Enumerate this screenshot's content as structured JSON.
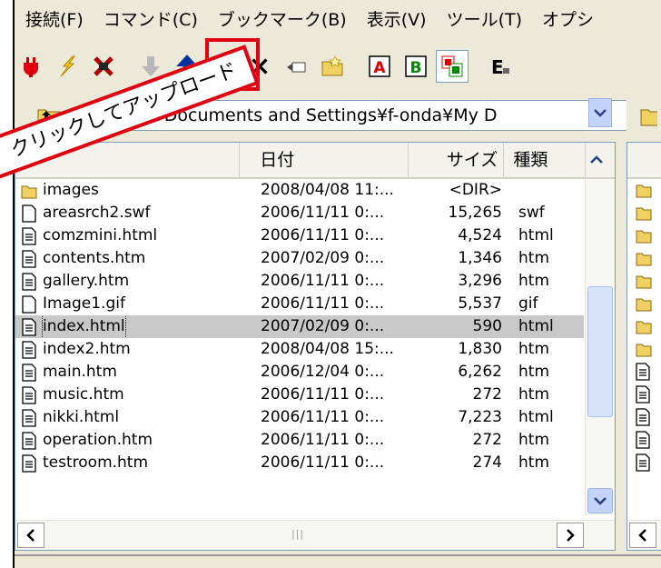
{
  "menu": [
    "接続(F)",
    "コマンド(C)",
    "ブックマーク(B)",
    "表示(V)",
    "ツール(T)",
    "オプシ"
  ],
  "toolbar": {
    "buttons": [
      {
        "name": "connect-plug-icon"
      },
      {
        "name": "quick-connect-bolt-icon"
      },
      {
        "name": "disconnect-icon"
      },
      {
        "name": "download-arrow-icon"
      },
      {
        "name": "upload-arrow-icon"
      },
      {
        "name": "mirror-upload-icon"
      },
      {
        "name": "delete-x-icon"
      },
      {
        "name": "rename-icon"
      },
      {
        "name": "new-folder-icon"
      },
      {
        "name": "ascii-mode-icon",
        "label": "A"
      },
      {
        "name": "binary-mode-icon",
        "label": "B"
      },
      {
        "name": "auto-mode-icon"
      },
      {
        "name": "encoding-icon",
        "label": "E"
      }
    ]
  },
  "address": {
    "path": "C:¥Documents and Settings¥f-onda¥My D"
  },
  "callout": {
    "text": "クリックしてアップロード"
  },
  "columns": {
    "name": "",
    "date": "日付",
    "size": "サイズ",
    "type": "種類"
  },
  "files": [
    {
      "icon": "folder",
      "name": "images",
      "date": "2008/04/08 11:...",
      "size": "<DIR>",
      "type": ""
    },
    {
      "icon": "blank",
      "name": "areasrch2.swf",
      "date": "2006/11/11 0:...",
      "size": "15,265",
      "type": "swf"
    },
    {
      "icon": "doc",
      "name": "comzmini.html",
      "date": "2006/11/11 0:...",
      "size": "4,524",
      "type": "html"
    },
    {
      "icon": "doc",
      "name": "contents.htm",
      "date": "2007/02/09 0:...",
      "size": "1,346",
      "type": "htm"
    },
    {
      "icon": "doc",
      "name": "gallery.htm",
      "date": "2006/11/11 0:...",
      "size": "3,296",
      "type": "htm"
    },
    {
      "icon": "blank",
      "name": "Image1.gif",
      "date": "2006/11/11 0:...",
      "size": "5,537",
      "type": "gif"
    },
    {
      "icon": "doc",
      "name": "index.html",
      "date": "2007/02/09 0:...",
      "size": "590",
      "type": "html",
      "selected": true
    },
    {
      "icon": "doc",
      "name": "index2.htm",
      "date": "2008/04/08 15:...",
      "size": "1,830",
      "type": "htm"
    },
    {
      "icon": "doc",
      "name": "main.htm",
      "date": "2006/12/04 0:...",
      "size": "6,262",
      "type": "htm"
    },
    {
      "icon": "doc",
      "name": "music.htm",
      "date": "2006/11/11 0:...",
      "size": "272",
      "type": "htm"
    },
    {
      "icon": "doc",
      "name": "nikki.html",
      "date": "2006/11/11 0:...",
      "size": "7,223",
      "type": "html"
    },
    {
      "icon": "doc",
      "name": "operation.htm",
      "date": "2006/11/11 0:...",
      "size": "272",
      "type": "htm"
    },
    {
      "icon": "doc",
      "name": "testroom.htm",
      "date": "2006/11/11 0:...",
      "size": "274",
      "type": "htm"
    }
  ],
  "colors": {
    "highlight": "#e00010",
    "upload": "#0032a0",
    "selection": "#c8c8c8"
  }
}
